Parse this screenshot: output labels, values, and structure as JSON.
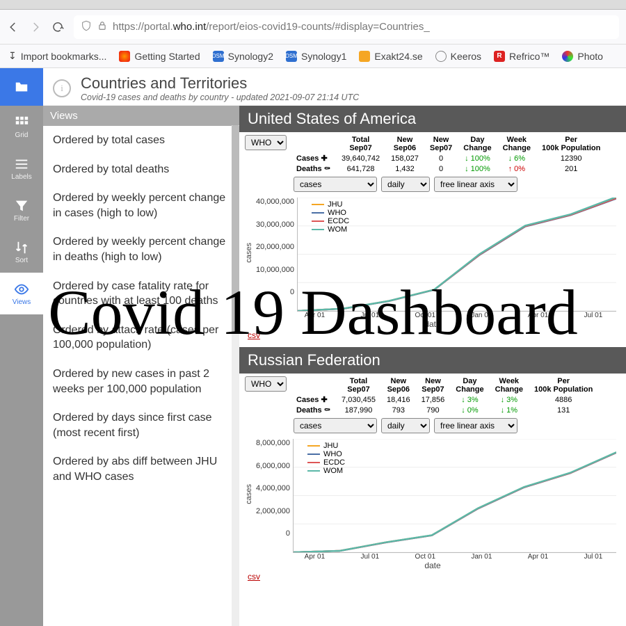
{
  "browser": {
    "url_prefix": "https://portal.",
    "url_domain": "who.int",
    "url_suffix": "/report/eios-covid19-counts/#display=Countries_",
    "bookmarks": [
      "Import bookmarks...",
      "Getting Started",
      "Synology2",
      "Synology1",
      "Exakt24.se",
      "Keeros",
      "Refrico™",
      "Photo"
    ]
  },
  "rail": {
    "grid": "Grid",
    "labels": "Labels",
    "filter": "Filter",
    "sort": "Sort",
    "views": "Views"
  },
  "header": {
    "title": "Countries and Territories",
    "subtitle": "Covid-19 cases and deaths by country - updated 2021-09-07 21:14 UTC"
  },
  "views": {
    "head": "Views",
    "items": [
      "Ordered by total cases",
      "Ordered by total deaths",
      "Ordered by weekly percent change in cases (high to low)",
      "Ordered by weekly percent change in deaths (high to low)",
      "Ordered by case fatality rate for countries with at least 100 deaths",
      "Ordered by attack rate (cases per 100,000 population)",
      "Ordered by new cases in past 2 weeks per 100,000 population",
      "Ordered by days since first case (most recent first)",
      "Ordered by abs diff between JHU and WHO cases"
    ]
  },
  "table_headers": [
    "Total Sep07",
    "New Sep06",
    "New Sep07",
    "Day Change",
    "Week Change",
    "Per 100k Population"
  ],
  "selectors": {
    "source": "WHO",
    "metric": "cases",
    "freq": "daily",
    "axis": "free linear axis"
  },
  "legend": {
    "jhu": "JHU",
    "who": "WHO",
    "ecdc": "ECDC",
    "wom": "WOM"
  },
  "csv": "csv",
  "countries": [
    {
      "name": "United States of America",
      "rows": {
        "cases": {
          "lbl": "Cases",
          "total": "39,640,742",
          "new06": "158,027",
          "new07": "0",
          "day": "↓ 100%",
          "week": "↓ 6%",
          "per": "12390"
        },
        "deaths": {
          "lbl": "Deaths",
          "total": "641,728",
          "new06": "1,432",
          "new07": "0",
          "day": "↓ 100%",
          "week": "↑ 0%",
          "per": "201"
        }
      },
      "yticks": [
        "40,000,000",
        "30,000,000",
        "20,000,000",
        "10,000,000",
        "0"
      ]
    },
    {
      "name": "Russian Federation",
      "rows": {
        "cases": {
          "lbl": "Cases",
          "total": "7,030,455",
          "new06": "18,416",
          "new07": "17,856",
          "day": "↓ 3%",
          "week": "↓ 3%",
          "per": "4886"
        },
        "deaths": {
          "lbl": "Deaths",
          "total": "187,990",
          "new06": "793",
          "new07": "790",
          "day": "↓ 0%",
          "week": "↓ 1%",
          "per": "131"
        }
      },
      "yticks": [
        "8,000,000",
        "6,000,000",
        "4,000,000",
        "2,000,000",
        "0"
      ]
    }
  ],
  "xticks": [
    "Apr 01",
    "Jul 01",
    "Oct 01",
    "Jan 01",
    "Apr 01",
    "Jul 01"
  ],
  "xlabel": "date",
  "ylabel": "cases",
  "overlay": "Covid 19 Dashboard",
  "chart_data": [
    {
      "type": "line",
      "title": "United States of America — cases (daily, free linear axis)",
      "xlabel": "date",
      "ylabel": "cases",
      "ylim": [
        0,
        40000000
      ],
      "x": [
        "2020-02",
        "2020-04",
        "2020-07",
        "2020-10",
        "2021-01",
        "2021-04",
        "2021-07",
        "2021-09"
      ],
      "series": [
        {
          "name": "JHU",
          "values": [
            0,
            800000,
            3500000,
            7500000,
            20000000,
            30000000,
            34000000,
            40000000
          ]
        },
        {
          "name": "WHO",
          "values": [
            0,
            780000,
            3450000,
            7450000,
            19800000,
            29800000,
            33800000,
            39640742
          ]
        },
        {
          "name": "ECDC",
          "values": [
            0,
            790000,
            3480000,
            7480000,
            19900000,
            29900000,
            33900000,
            39800000
          ]
        },
        {
          "name": "WOM",
          "values": [
            0,
            810000,
            3520000,
            7520000,
            20100000,
            30100000,
            34100000,
            40200000
          ]
        }
      ]
    },
    {
      "type": "line",
      "title": "Russian Federation — cases (daily, free linear axis)",
      "xlabel": "date",
      "ylabel": "cases",
      "ylim": [
        0,
        8000000
      ],
      "x": [
        "2020-02",
        "2020-04",
        "2020-07",
        "2020-10",
        "2021-01",
        "2021-04",
        "2021-07",
        "2021-09"
      ],
      "series": [
        {
          "name": "JHU",
          "values": [
            0,
            100000,
            700000,
            1200000,
            3100000,
            4600000,
            5600000,
            7050000
          ]
        },
        {
          "name": "WHO",
          "values": [
            0,
            98000,
            690000,
            1190000,
            3080000,
            4580000,
            5580000,
            7030455
          ]
        },
        {
          "name": "ECDC",
          "values": [
            0,
            99000,
            695000,
            1195000,
            3090000,
            4590000,
            5590000,
            7040000
          ]
        },
        {
          "name": "WOM",
          "values": [
            0,
            101000,
            705000,
            1205000,
            3110000,
            4610000,
            5610000,
            7060000
          ]
        }
      ]
    }
  ]
}
